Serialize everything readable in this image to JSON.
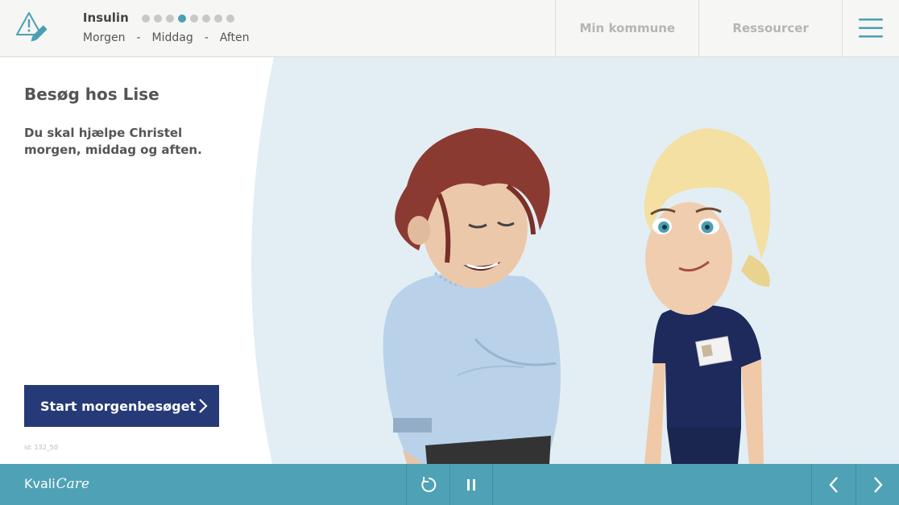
{
  "header": {
    "module_title": "Insulin",
    "progress": {
      "total_steps": 8,
      "current_step": 4
    },
    "phases": [
      "Morgen",
      "-",
      "Middag",
      "-",
      "Aften"
    ],
    "nav": {
      "my_municipality": "Min kommune",
      "resources": "Ressourcer"
    }
  },
  "panel": {
    "title": "Besøg hos Lise",
    "text": "Du skal hjælpe Christel morgen, middag og aften.",
    "start_button": "Start morgenbesøget",
    "slide_id": "id: 132_50"
  },
  "footer": {
    "brand_prefix": "Kvali",
    "brand_suffix": "Care"
  },
  "colors": {
    "accent": "#4fa2b5",
    "primary_button": "#263a78",
    "scene_background": "#e2eef3",
    "active_dot": "#4a9fb4"
  }
}
